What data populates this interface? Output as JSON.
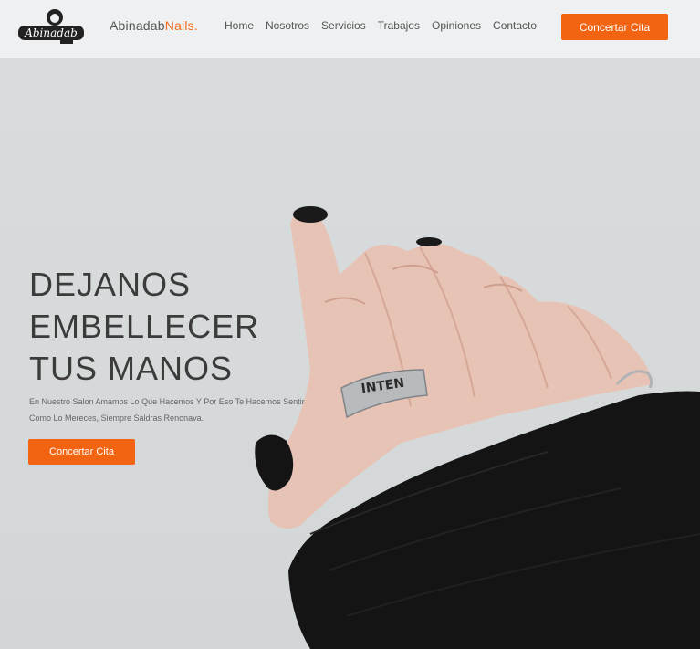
{
  "header": {
    "logo_text": "Abinadab",
    "brand_name": "Abinadab",
    "brand_accent": "Nails.",
    "nav": [
      "Home",
      "Nosotros",
      "Servicios",
      "Trabajos",
      "Opiniones",
      "Contacto"
    ],
    "cta_label": "Concertar Cita"
  },
  "hero": {
    "title": "DEJANOS EMBELLECER TUS MANOS",
    "subtitle": "En Nuestro Salon Amamos Lo Que Hacemos Y Por Eso Te Hacemos Sentir Como Lo Mereces, Siempre Saldras Renonava.",
    "cta_label": "Concertar Cita",
    "ring_text": "INTEN"
  },
  "colors": {
    "accent": "#f26312",
    "text_dark": "#3b3b3b",
    "background": "#d7dbdc"
  }
}
